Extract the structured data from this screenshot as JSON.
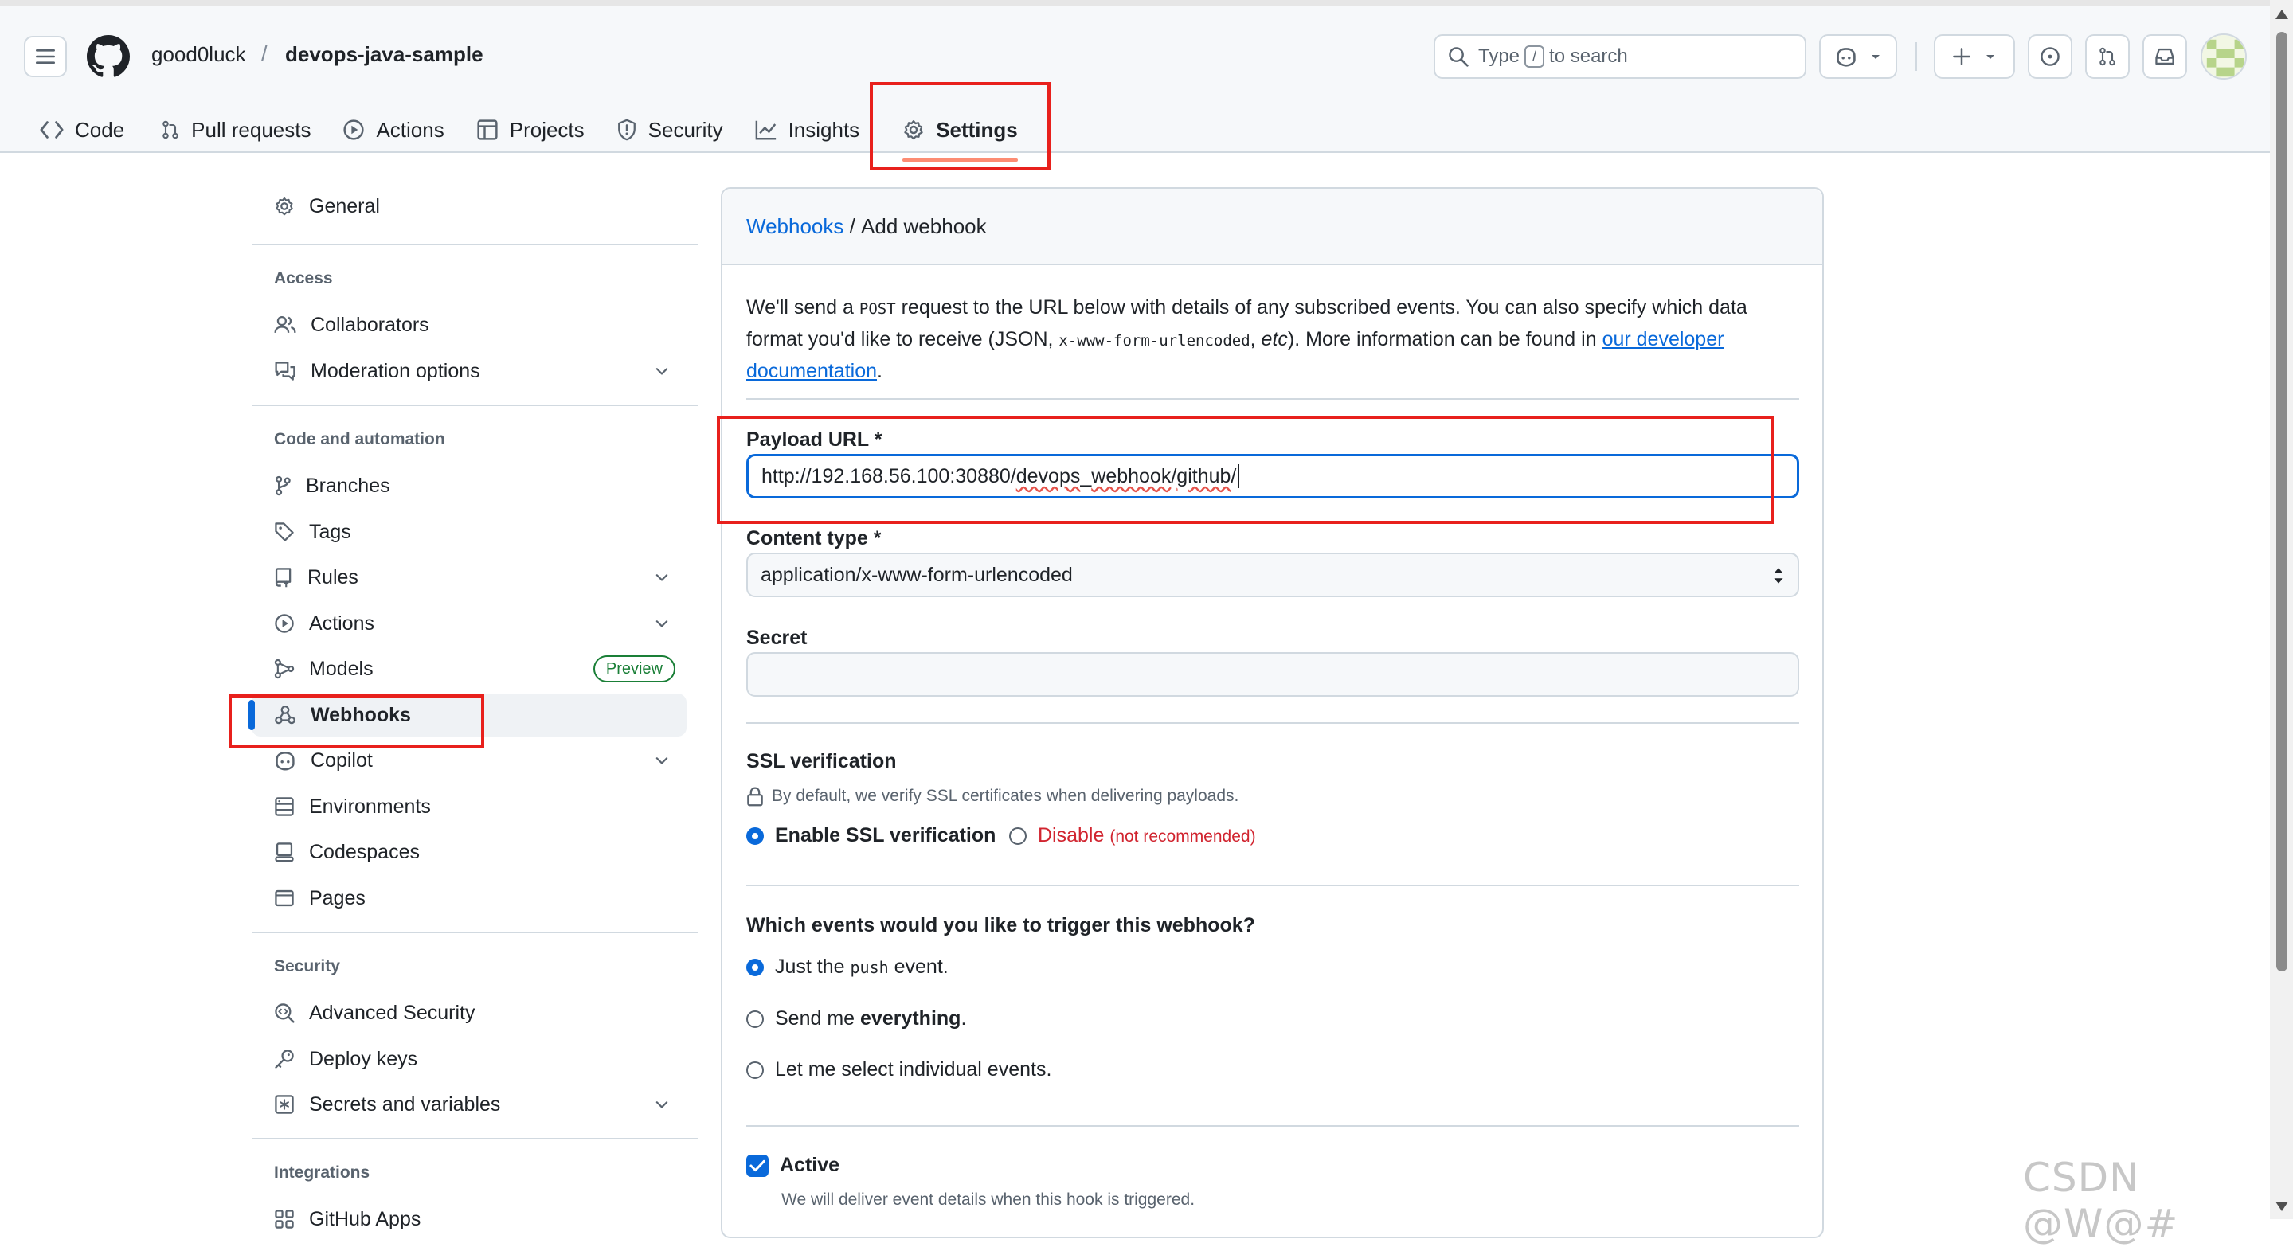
{
  "header": {
    "owner": "good0luck",
    "separator": "/",
    "repo": "devops-java-sample",
    "search": {
      "before": "Type",
      "key": "/",
      "after": "to search"
    }
  },
  "tabs": [
    {
      "label": "Code",
      "icon": "code-icon"
    },
    {
      "label": "Pull requests",
      "icon": "pull-request-icon"
    },
    {
      "label": "Actions",
      "icon": "play-icon"
    },
    {
      "label": "Projects",
      "icon": "table-icon"
    },
    {
      "label": "Security",
      "icon": "shield-icon"
    },
    {
      "label": "Insights",
      "icon": "graph-icon"
    },
    {
      "label": "Settings",
      "icon": "gear-icon",
      "selected": true
    }
  ],
  "sidebar": {
    "general": "General",
    "access_heading": "Access",
    "collaborators": "Collaborators",
    "moderation": "Moderation options",
    "code_heading": "Code and automation",
    "branches": "Branches",
    "tags": "Tags",
    "rules": "Rules",
    "actions": "Actions",
    "models": "Models",
    "models_badge": "Preview",
    "webhooks": "Webhooks",
    "copilot": "Copilot",
    "environments": "Environments",
    "codespaces": "Codespaces",
    "pages": "Pages",
    "security_heading": "Security",
    "advanced_security": "Advanced Security",
    "deploy_keys": "Deploy keys",
    "secrets": "Secrets and variables",
    "integrations_heading": "Integrations",
    "github_apps": "GitHub Apps"
  },
  "panel": {
    "crumb_link": "Webhooks",
    "crumb_sep": " / ",
    "crumb_current": "Add webhook",
    "intro": {
      "p1": "We'll send a ",
      "post": "POST",
      "p2": " request to the URL below with details of any subscribed events. You can also specify which data format you'd like to receive (JSON, ",
      "form": "x-www-form-urlencoded",
      "p3": ", ",
      "etc": "etc",
      "p4": "). More information can be found in ",
      "link": "our developer documentation",
      "p5": "."
    },
    "payload_label": "Payload URL *",
    "payload_value_a": "http://192.168.56.100:30880/",
    "payload_value_b": "devops",
    "payload_value_c": "_",
    "payload_value_d": "webhook",
    "payload_value_e": "/",
    "payload_value_f": "github",
    "payload_value_g": "/",
    "content_type_label": "Content type *",
    "content_type_value": "application/x-www-form-urlencoded",
    "secret_label": "Secret",
    "secret_value": "",
    "ssl_label": "SSL verification",
    "ssl_note": "By default, we verify SSL certificates when delivering payloads.",
    "ssl_enable": "Enable SSL verification",
    "ssl_disable": "Disable",
    "ssl_disable_note": "(not recommended)",
    "events_label": "Which events would you like to trigger this webhook?",
    "event_push_a": "Just the ",
    "event_push_code": "push",
    "event_push_b": " event.",
    "event_all_a": "Send me ",
    "event_all_b": "everything",
    "event_all_c": ".",
    "event_select": "Let me select individual events.",
    "active_label": "Active",
    "active_note": "We will deliver event details when this hook is triggered."
  },
  "watermark": "CSDN @W@#",
  "colors": {
    "accent": "#0969da",
    "annotation": "#e8201c",
    "danger": "#d1242f",
    "tab_underline": "#fd8c73"
  }
}
